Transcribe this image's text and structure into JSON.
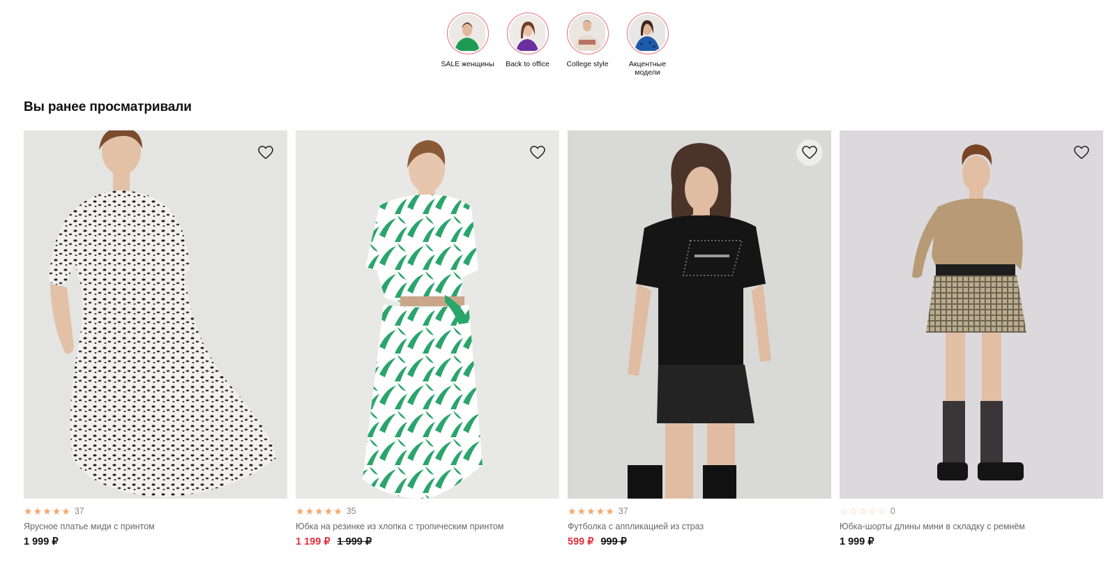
{
  "stories": [
    {
      "label": "SALE женщины",
      "icon": "story-thumbnail-sale"
    },
    {
      "label": "Back to office",
      "icon": "story-thumbnail-office"
    },
    {
      "label": "College style",
      "icon": "story-thumbnail-college"
    },
    {
      "label": "Акцентные модели",
      "icon": "story-thumbnail-accent"
    }
  ],
  "section": {
    "title": "Вы ранее просматривали"
  },
  "products": [
    {
      "rating_count": "37",
      "stars": 5,
      "name": "Ярусное платье миди с принтом",
      "price": "1 999 ₽",
      "old_price": "",
      "on_sale": false
    },
    {
      "rating_count": "35",
      "stars": 5,
      "name": "Юбка на резинке из хлопка с тропическим принтом",
      "price": "1 199 ₽",
      "old_price": "1 999 ₽",
      "on_sale": true
    },
    {
      "rating_count": "37",
      "stars": 5,
      "name": "Футболка с аппликацией из страз",
      "price": "599 ₽",
      "old_price": "999 ₽",
      "on_sale": true
    },
    {
      "rating_count": "0",
      "stars": 0,
      "name": "Юбка-шорты длины мини в складку с ремнём",
      "price": "1 999 ₽",
      "old_price": "",
      "on_sale": false
    }
  ],
  "colors": {
    "sale": "#e0313c",
    "star": "#f4a76a",
    "story_ring": "#e8707e"
  }
}
